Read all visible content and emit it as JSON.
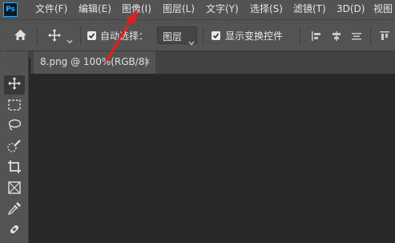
{
  "app": {
    "logo_text": "Ps"
  },
  "menu": [
    {
      "label": "文件(F)"
    },
    {
      "label": "编辑(E)"
    },
    {
      "label": "图像(I)"
    },
    {
      "label": "图层(L)"
    },
    {
      "label": "文字(Y)"
    },
    {
      "label": "选择(S)"
    },
    {
      "label": "滤镜(T)"
    },
    {
      "label": "3D(D)"
    },
    {
      "label": "视图"
    }
  ],
  "options": {
    "auto_select_label": "自动选择：",
    "auto_select_checked": true,
    "layer_select_value": "图层",
    "show_transform_label": "显示变换控件",
    "show_transform_checked": true
  },
  "document": {
    "tab_label": "8.png @ 100%(RGB/8)",
    "close_glyph": "×"
  },
  "panel": {
    "collapse_glyph": "»"
  },
  "tools": [
    {
      "icon": "move-icon"
    },
    {
      "icon": "rectangular-marquee-icon"
    },
    {
      "icon": "lasso-icon"
    },
    {
      "icon": "quick-selection-icon"
    },
    {
      "icon": "crop-icon"
    },
    {
      "icon": "frame-icon"
    },
    {
      "icon": "eyedropper-icon"
    },
    {
      "icon": "healing-brush-icon"
    }
  ],
  "colors": {
    "menubar": "#535353",
    "canvas": "#282828",
    "annotation_arrow": "#e02020",
    "ps_blue": "#31a8ff"
  }
}
